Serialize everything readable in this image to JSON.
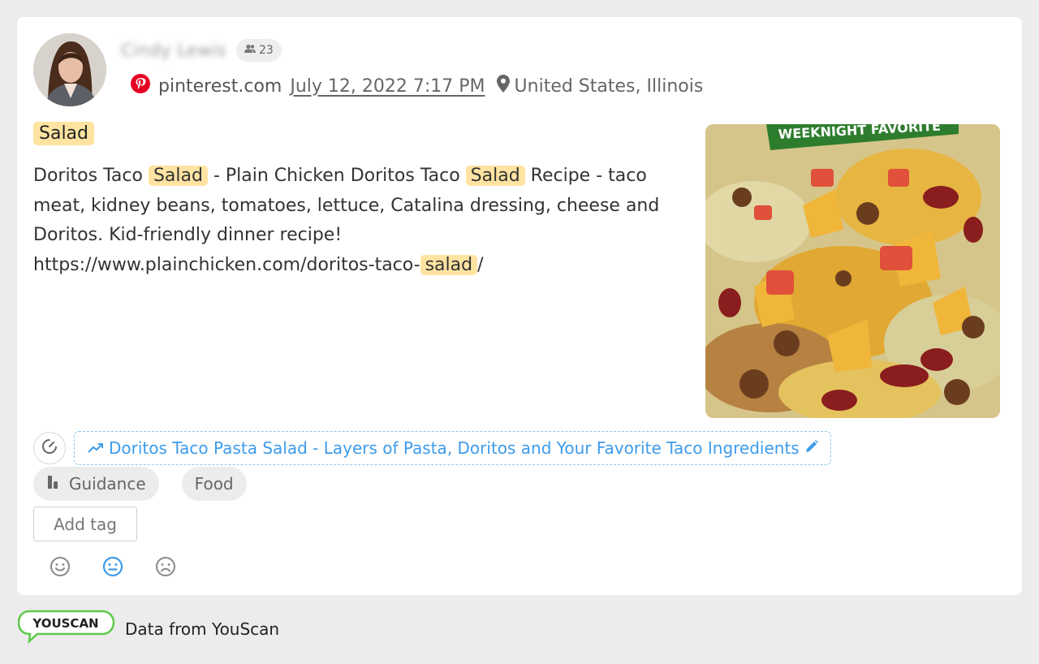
{
  "post": {
    "author_name": "Cindy Lewis",
    "followers_count": "23",
    "source": "pinterest.com",
    "date": "July 12, 2022 7:17 PM",
    "location": "United States, Illinois",
    "topic_tag": "Salad",
    "text": {
      "seg1": "Doritos Taco ",
      "hl1": "Salad",
      "seg2": " - Plain Chicken Doritos Taco ",
      "hl2": "Salad",
      "seg3": " Recipe - taco meat, kidney beans, tomatoes, lettuce, Catalina dressing, cheese and Doritos. Kid-friendly dinner recipe! https://www.plainchicken.com/doritos-taco-",
      "hl3": "salad",
      "seg4": "/"
    },
    "image_banner": "WEEKNIGHT FAVORITE",
    "cluster_title": "Doritos Taco Pasta Salad - Layers of Pasta, Doritos and Your Favorite Taco Ingredients"
  },
  "tags": [
    {
      "label": "Guidance",
      "icon": "boot-icon"
    },
    {
      "label": "Food"
    }
  ],
  "add_tag_label": "Add tag",
  "sentiment": {
    "selected": "neutral",
    "colors": {
      "default": "#888888",
      "selected": "#3d9bea"
    }
  },
  "footer": {
    "logo_text": "YOUSCAN",
    "text": "Data from YouScan",
    "logo_color": "#5fc94a"
  },
  "colors": {
    "highlight": "#ffe3a1",
    "link": "#3d9bea",
    "pinterest": "#e60023"
  }
}
